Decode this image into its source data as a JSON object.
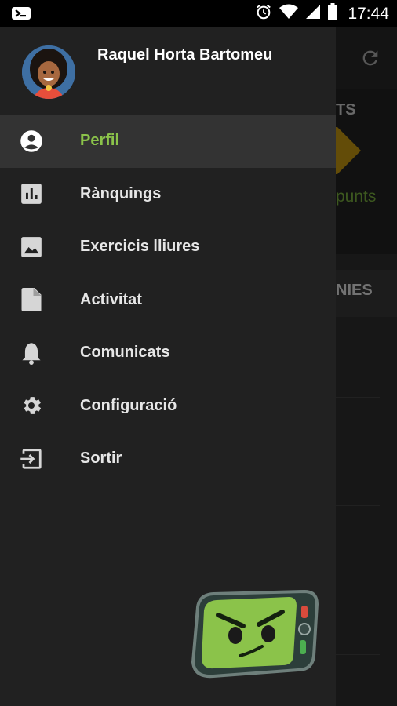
{
  "status_bar": {
    "time": "17:44",
    "icons": [
      "app-notification-icon",
      "alarm-icon",
      "wifi-icon",
      "signal-icon",
      "battery-icon"
    ]
  },
  "background_screen": {
    "visible_text_fragments": [
      "TS",
      "punts",
      "NIES"
    ],
    "refresh_icon": "refresh-icon"
  },
  "drawer": {
    "user": {
      "name": "Raquel Horta Bartomeu",
      "avatar": "avatar-icon"
    },
    "menu": [
      {
        "label": "Perfil",
        "icon": "account-circle-icon",
        "active": true
      },
      {
        "label": "Rànquings",
        "icon": "chart-icon",
        "active": false
      },
      {
        "label": "Exercicis lliures",
        "icon": "image-icon",
        "active": false
      },
      {
        "label": "Activitat",
        "icon": "document-icon",
        "active": false
      },
      {
        "label": "Comunicats",
        "icon": "bell-icon",
        "active": false
      },
      {
        "label": "Configuració",
        "icon": "gear-icon",
        "active": false
      },
      {
        "label": "Sortir",
        "icon": "exit-icon",
        "active": false
      }
    ],
    "mascot": "mascot-phone-icon"
  },
  "colors": {
    "accent_green": "#8bc34a",
    "drawer_bg": "#212121",
    "active_row_bg": "#333333",
    "text": "#e6e6e6"
  }
}
